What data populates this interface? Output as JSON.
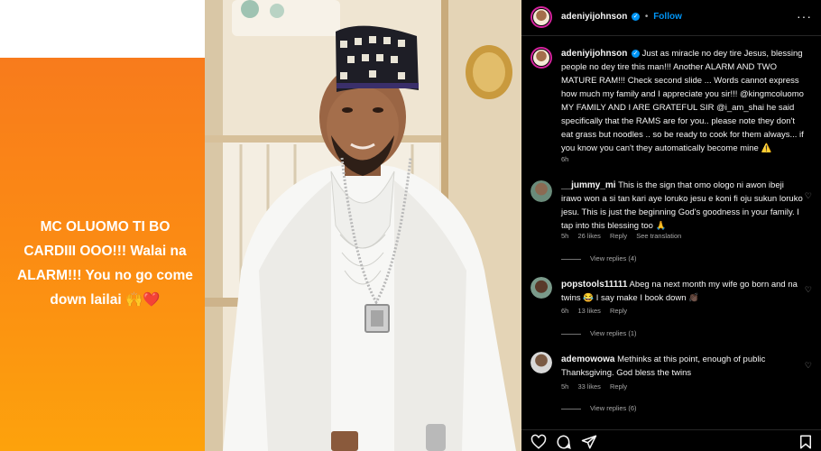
{
  "story": {
    "text": "MC OLUOMO TI BO CARDIII OOO!!! Walai na ALARM!!! You no go come down lailai",
    "emojis": "🙌❤️"
  },
  "post": {
    "username": "adeniyijohnson",
    "follow_label": "Follow",
    "more_icon": "more-icon",
    "caption": "Just as miracle no dey tire Jesus, blessing people no dey tire this man!!! Another ALARM AND TWO MATURE RAM!!! Check second slide ... Words cannot express how much my family and I appreciate you sir!!! @kingmcoluomo MY FAMILY AND I ARE GRATEFUL SIR @i_am_shai he said specifically that the RAMS are for you.. please note they don't eat grass but noodles .. so be ready to cook for them always... if you know you can't they automatically become mine ⚠️",
    "caption_time": "6h"
  },
  "comments": [
    {
      "username": "__jummy_mi",
      "text": "This is the sign that omo ologo ni awon ibeji irawo won a si tan kari aye loruko jesu e koni fi oju sukun loruko jesu. This is just the beginning God's goodness in your family. I tap into this blessing too 🙏",
      "time": "5h",
      "likes": "26 likes",
      "reply": "Reply",
      "translation": "See translation",
      "view_replies": "View replies (4)"
    },
    {
      "username": "popstools11111",
      "text": "Abeg na next month my wife go born and na twins 😂 I say make I book down 👏🏿",
      "time": "6h",
      "likes": "13 likes",
      "reply": "Reply",
      "view_replies": "View replies (1)"
    },
    {
      "username": "ademowowa",
      "text": "Methinks at this point, enough of public Thanksgiving. God bless the twins",
      "time": "5h",
      "likes": "33 likes",
      "reply": "Reply",
      "view_replies": "View replies (6)"
    }
  ],
  "colors": {
    "accent": "#0095f6",
    "orange_top": "#f87b1c",
    "orange_bottom": "#fda20c",
    "panel_bg": "#000000",
    "muted": "#a8a8a8"
  }
}
